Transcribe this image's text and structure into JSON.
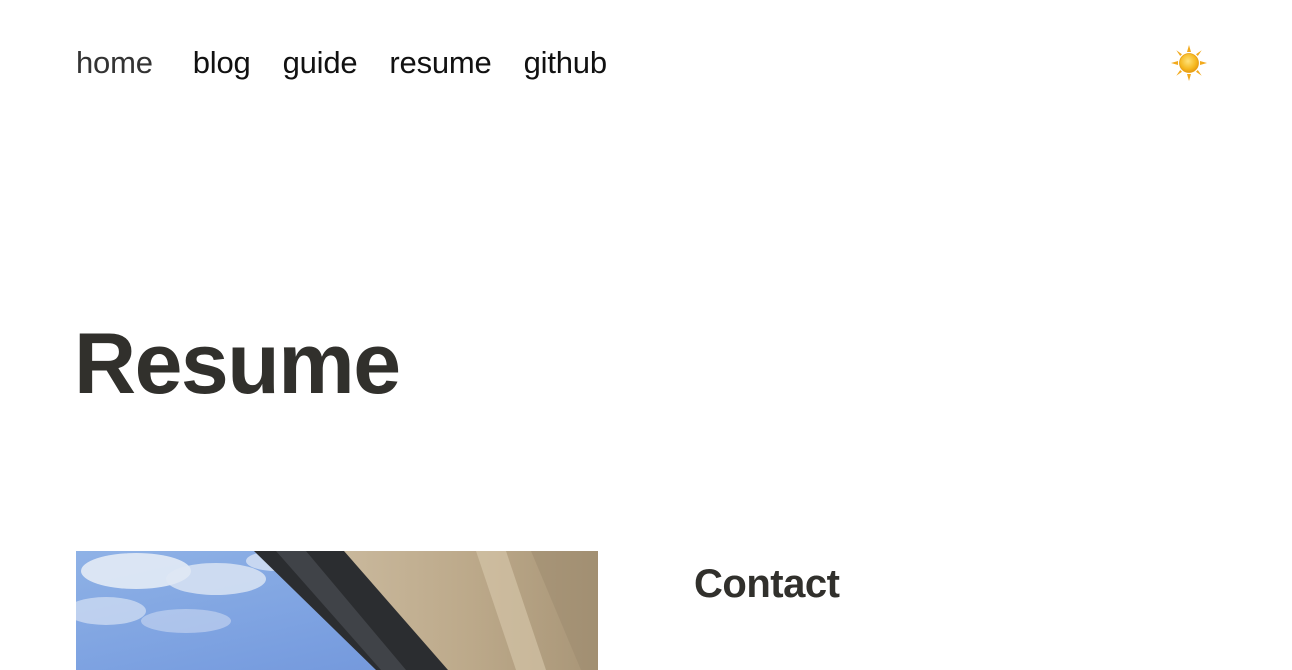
{
  "nav": {
    "items": [
      {
        "label": "home"
      },
      {
        "label": "blog"
      },
      {
        "label": "guide"
      },
      {
        "label": "resume"
      },
      {
        "label": "github"
      }
    ],
    "theme_toggle_icon": "sun-icon"
  },
  "page": {
    "title": "Resume"
  },
  "contact": {
    "heading": "Contact"
  },
  "photo": {
    "icon": "profile-photo"
  },
  "colors": {
    "heading": "#31302c",
    "nav_text": "#111111",
    "sun": "#f5b820"
  }
}
